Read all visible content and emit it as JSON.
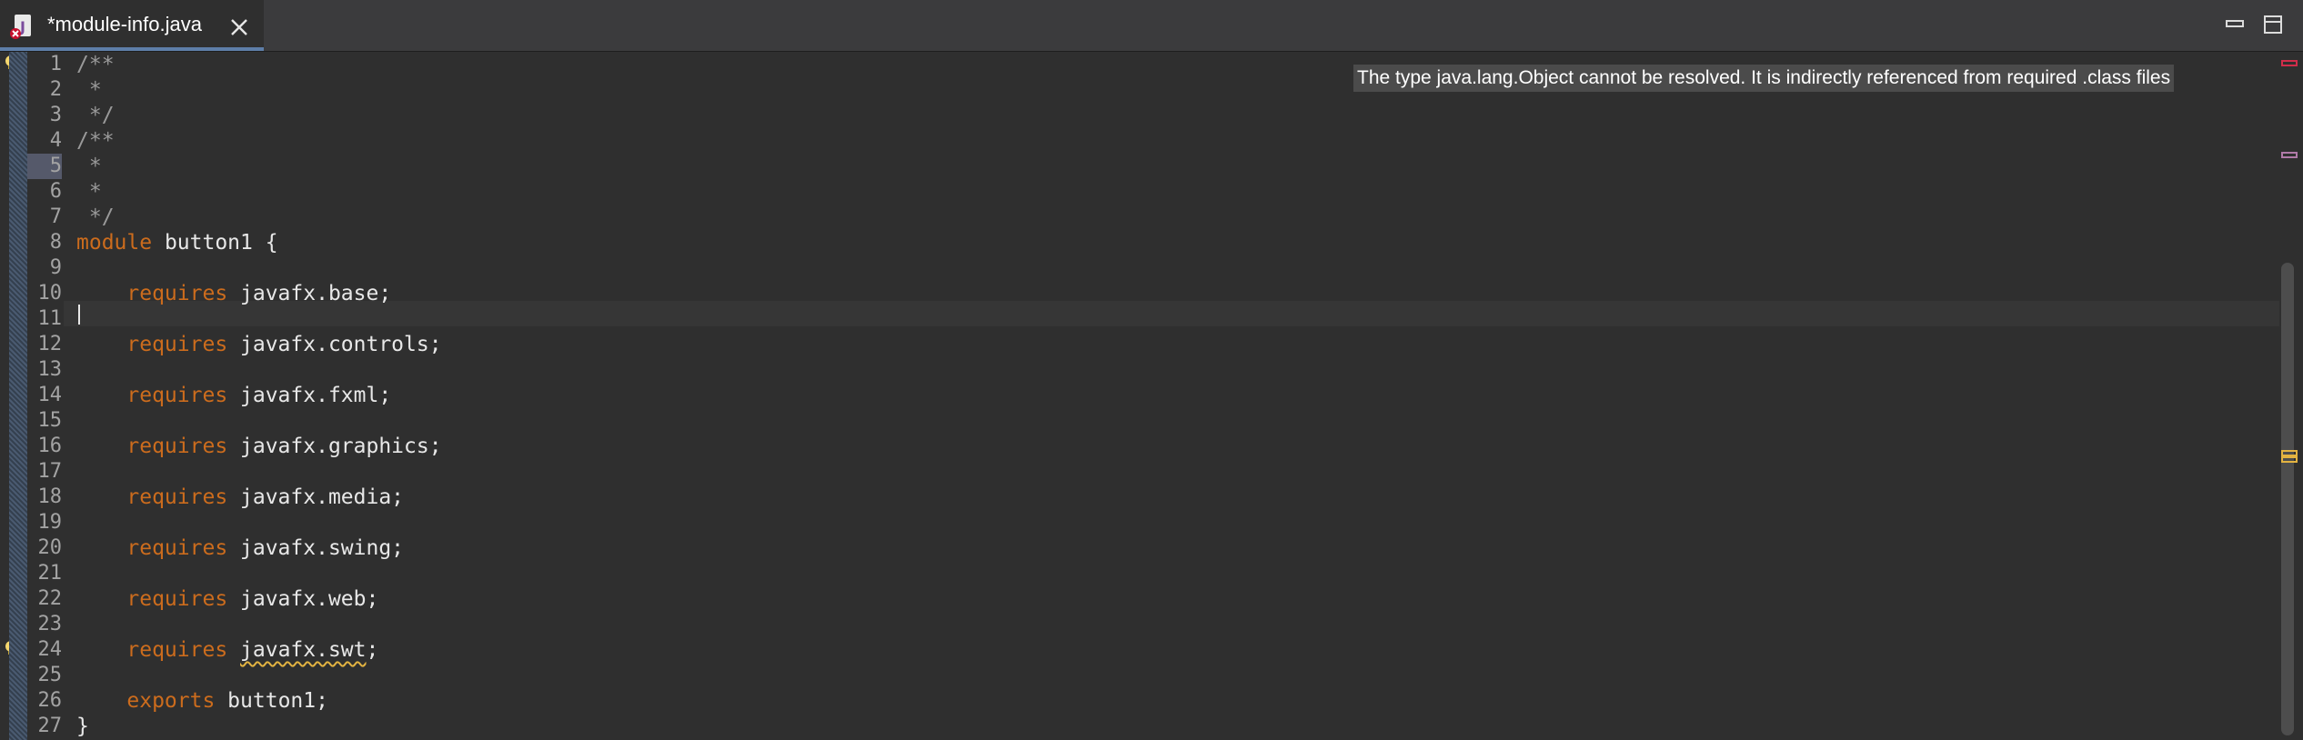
{
  "tab": {
    "label": "*module-info.java",
    "icon": "java-module-error-icon"
  },
  "window_controls": {
    "minimize": "minimize-icon",
    "maximize": "maximize-icon"
  },
  "hover": {
    "error_message": "The type java.lang.Object cannot be resolved. It is indirectly referenced from required .class files"
  },
  "editor": {
    "current_line": 11,
    "highlighted_line": 5,
    "line_numbers": [
      "1",
      "2",
      "3",
      "4",
      "5",
      "6",
      "7",
      "8",
      "9",
      "10",
      "11",
      "12",
      "13",
      "14",
      "15",
      "16",
      "17",
      "18",
      "19",
      "20",
      "21",
      "22",
      "23",
      "24",
      "25",
      "26",
      "27"
    ],
    "lines": [
      [
        {
          "t": "/**",
          "c": "cm"
        }
      ],
      [
        {
          "t": " *",
          "c": "cm"
        }
      ],
      [
        {
          "t": " */",
          "c": "cm"
        }
      ],
      [
        {
          "t": "/**",
          "c": "cm"
        }
      ],
      [
        {
          "t": " *",
          "c": "cm"
        }
      ],
      [
        {
          "t": " *",
          "c": "cm"
        }
      ],
      [
        {
          "t": " */",
          "c": "cm"
        }
      ],
      [
        {
          "t": "module",
          "c": "kw"
        },
        {
          "t": " button1 {",
          "c": "id"
        }
      ],
      [],
      [
        {
          "t": "    "
        },
        {
          "t": "requires",
          "c": "kw"
        },
        {
          "t": " javafx.base;",
          "c": "id"
        }
      ],
      [],
      [
        {
          "t": "    "
        },
        {
          "t": "requires",
          "c": "kw"
        },
        {
          "t": " javafx.controls;",
          "c": "id"
        }
      ],
      [],
      [
        {
          "t": "    "
        },
        {
          "t": "requires",
          "c": "kw"
        },
        {
          "t": " javafx.fxml;",
          "c": "id"
        }
      ],
      [],
      [
        {
          "t": "    "
        },
        {
          "t": "requires",
          "c": "kw"
        },
        {
          "t": " javafx.graphics;",
          "c": "id"
        }
      ],
      [],
      [
        {
          "t": "    "
        },
        {
          "t": "requires",
          "c": "kw"
        },
        {
          "t": " javafx.media;",
          "c": "id"
        }
      ],
      [],
      [
        {
          "t": "    "
        },
        {
          "t": "requires",
          "c": "kw"
        },
        {
          "t": " javafx.swing;",
          "c": "id"
        }
      ],
      [],
      [
        {
          "t": "    "
        },
        {
          "t": "requires",
          "c": "kw"
        },
        {
          "t": " javafx.web;",
          "c": "id"
        }
      ],
      [],
      [
        {
          "t": "    "
        },
        {
          "t": "requires",
          "c": "kw"
        },
        {
          "t": " ",
          "c": "id"
        },
        {
          "t": "javafx.swt",
          "c": "id",
          "u": "warn"
        },
        {
          "t": ";",
          "c": "id"
        }
      ],
      [],
      [
        {
          "t": "    "
        },
        {
          "t": "exports",
          "c": "kw"
        },
        {
          "t": " button1;",
          "c": "id"
        }
      ],
      [
        {
          "t": "}",
          "c": "id"
        }
      ]
    ]
  },
  "annotations": [
    {
      "line": 1,
      "icon": "error-lightbulb-icon"
    },
    {
      "line": 24,
      "icon": "warning-lightbulb-icon"
    }
  ],
  "overview_marks": [
    {
      "fraction": 0.012,
      "color": "#d12d4a",
      "kind": "error"
    },
    {
      "fraction": 0.145,
      "color": "#b07aa8",
      "kind": "occurrence"
    },
    {
      "fraction": 0.578,
      "color": "#e3b341",
      "kind": "warning"
    },
    {
      "fraction": 0.588,
      "color": "#e3b341",
      "kind": "warning"
    }
  ],
  "colors": {
    "keyword": "#cc6c1d",
    "comment": "#9a9a9a",
    "identifier": "#e8e8e8",
    "warning": "#e3b341",
    "error": "#d12d4a",
    "tab_accent": "#5e7ea8"
  }
}
